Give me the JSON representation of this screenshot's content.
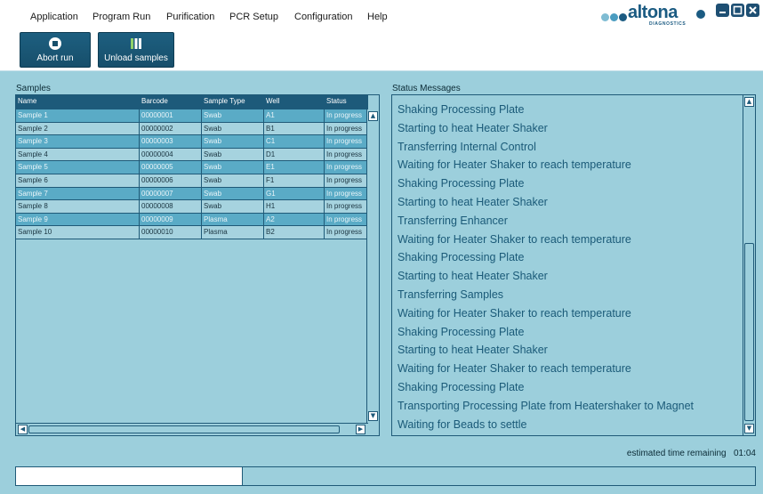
{
  "menu": [
    "Application",
    "Program Run",
    "Purification",
    "PCR Setup",
    "Configuration",
    "Help"
  ],
  "logo": {
    "name": "altona",
    "subtitle": "DIAGNOSTICS",
    "dot_colors": [
      "#7fbcd3",
      "#4a9cc0",
      "#1b5b82"
    ]
  },
  "window_controls": [
    "minimize-icon",
    "maximize-icon",
    "close-icon"
  ],
  "toolbar": {
    "abort_label": "Abort run",
    "unload_label": "Unload samples",
    "abort_icon": "stop-icon",
    "unload_icon": "unload-icon"
  },
  "samples": {
    "label": "Samples",
    "columns": [
      "Name",
      "Barcode",
      "Sample Type",
      "Well",
      "Status"
    ],
    "rows": [
      [
        "Sample 1",
        "00000001",
        "Swab",
        "A1",
        "In progress"
      ],
      [
        "Sample 2",
        "00000002",
        "Swab",
        "B1",
        "In progress"
      ],
      [
        "Sample 3",
        "00000003",
        "Swab",
        "C1",
        "In progress"
      ],
      [
        "Sample 4",
        "00000004",
        "Swab",
        "D1",
        "In progress"
      ],
      [
        "Sample 5",
        "00000005",
        "Swab",
        "E1",
        "In progress"
      ],
      [
        "Sample 6",
        "00000006",
        "Swab",
        "F1",
        "In progress"
      ],
      [
        "Sample 7",
        "00000007",
        "Swab",
        "G1",
        "In progress"
      ],
      [
        "Sample 8",
        "00000008",
        "Swab",
        "H1",
        "In progress"
      ],
      [
        "Sample 9",
        "00000009",
        "Plasma",
        "A2",
        "In progress"
      ],
      [
        "Sample 10",
        "00000010",
        "Plasma",
        "B2",
        "In progress"
      ]
    ]
  },
  "status": {
    "label": "Status Messages",
    "messages": [
      "Shaking Processing Plate",
      "Starting to heat Heater Shaker",
      "Transferring Internal Control",
      "Waiting for Heater Shaker to reach temperature",
      "Shaking Processing Plate",
      "Starting to heat Heater Shaker",
      "Transferring Enhancer",
      "Waiting for Heater Shaker to reach temperature",
      "Shaking Processing Plate",
      "Starting to heat Heater Shaker",
      "Transferring Samples",
      "Waiting for Heater Shaker to reach temperature",
      "Shaking Processing Plate",
      "Starting to heat Heater Shaker",
      "Waiting for Heater Shaker to reach temperature",
      "Shaking Processing Plate",
      "Transporting Processing Plate from Heatershaker to Magnet",
      "Waiting for Beads to settle"
    ]
  },
  "estimated_time": {
    "label": "estimated time remaining",
    "value": "01:04"
  },
  "progress": {
    "fraction": 0.307
  },
  "colors": {
    "background": "#9ccfdc",
    "header": "#1d5a7a",
    "row_dark": "#5aabc6",
    "row_light": "#a6d3df",
    "message_text": "#1a5a78"
  }
}
